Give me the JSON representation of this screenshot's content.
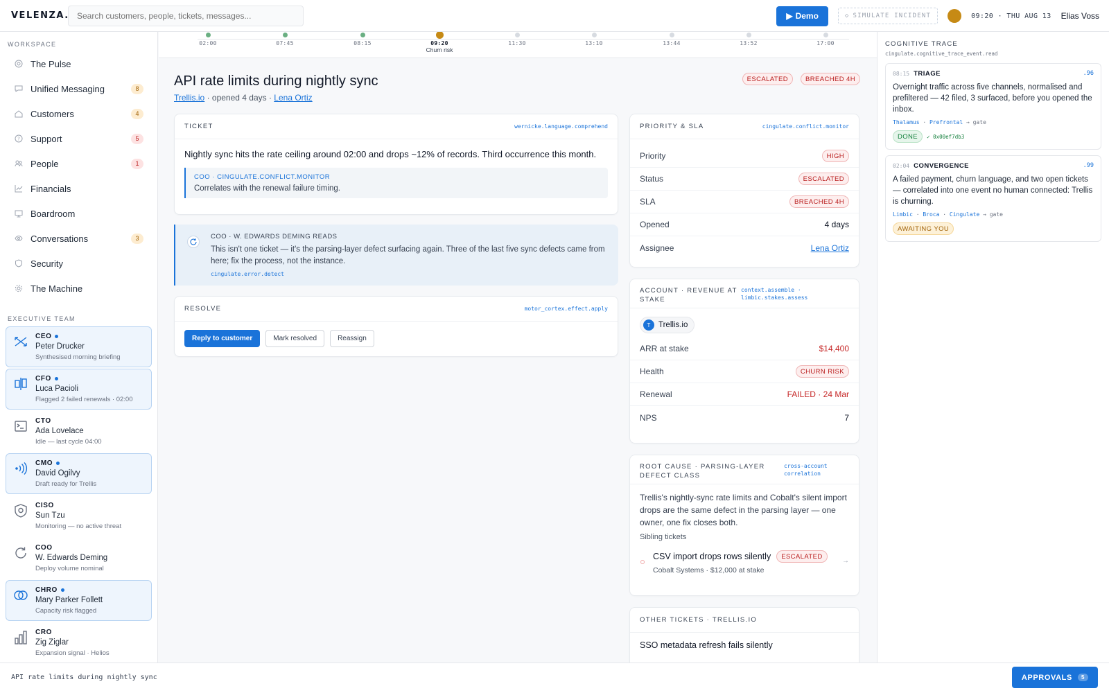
{
  "header": {
    "logo": "VELENZA.",
    "search_placeholder": "Search customers, people, tickets, messages...",
    "demo_label": "Demo",
    "simulate_label": "SIMULATE INCIDENT",
    "clock": "09:20 · THU AUG 13",
    "user": "Elias Voss"
  },
  "sidebar": {
    "workspace_label": "WORKSPACE",
    "items": [
      {
        "label": "The Pulse",
        "badge": "",
        "icon": "pulse-icon"
      },
      {
        "label": "Unified Messaging",
        "badge": "8",
        "icon": "message-icon"
      },
      {
        "label": "Customers",
        "badge": "4",
        "icon": "home-icon"
      },
      {
        "label": "Support",
        "badge": "5",
        "icon": "help-icon"
      },
      {
        "label": "People",
        "badge": "1",
        "icon": "people-icon"
      },
      {
        "label": "Financials",
        "badge": "",
        "icon": "chart-icon"
      },
      {
        "label": "Boardroom",
        "badge": "",
        "icon": "monitor-icon"
      },
      {
        "label": "Conversations",
        "badge": "3",
        "icon": "eye-icon"
      },
      {
        "label": "Security",
        "badge": "",
        "icon": "shield-icon"
      },
      {
        "label": "The Machine",
        "badge": "",
        "icon": "gear-icon"
      }
    ],
    "exec_label": "EXECUTIVE TEAM",
    "execs": [
      {
        "role": "CEO",
        "name": "Peter Drucker",
        "status": "Synthesised morning briefing",
        "active": true
      },
      {
        "role": "CFO",
        "name": "Luca Pacioli",
        "status": "Flagged 2 failed renewals · 02:00",
        "active": true
      },
      {
        "role": "CTO",
        "name": "Ada Lovelace",
        "status": "Idle — last cycle 04:00",
        "active": false
      },
      {
        "role": "CMO",
        "name": "David Ogilvy",
        "status": "Draft ready for Trellis",
        "active": true
      },
      {
        "role": "CISO",
        "name": "Sun Tzu",
        "status": "Monitoring — no active threat",
        "active": false
      },
      {
        "role": "COO",
        "name": "W. Edwards Deming",
        "status": "Deploy volume nominal",
        "active": false
      },
      {
        "role": "CHRO",
        "name": "Mary Parker Follett",
        "status": "Capacity risk flagged",
        "active": true
      },
      {
        "role": "CRO",
        "name": "Zig Ziglar",
        "status": "Expansion signal · Helios",
        "active": false
      }
    ]
  },
  "timeline": [
    {
      "time": "02:00",
      "state": "done",
      "label": ""
    },
    {
      "time": "07:45",
      "state": "done",
      "label": ""
    },
    {
      "time": "08:15",
      "state": "done",
      "label": ""
    },
    {
      "time": "09:20",
      "state": "now",
      "label": "Churn risk"
    },
    {
      "time": "11:30",
      "state": "future",
      "label": ""
    },
    {
      "time": "13:10",
      "state": "future",
      "label": ""
    },
    {
      "time": "13:44",
      "state": "future",
      "label": ""
    },
    {
      "time": "13:52",
      "state": "future",
      "label": ""
    },
    {
      "time": "17:00",
      "state": "future",
      "label": ""
    }
  ],
  "ticket_page": {
    "title": "API rate limits during nightly sync",
    "account": "Trellis.io",
    "opened": " · opened 4 days · ",
    "owner": "Lena Ortiz",
    "pill_escalated": "ESCALATED",
    "pill_breached": "BREACHED 4H"
  },
  "ticket_card": {
    "title": "TICKET",
    "tag": "wernicke.language.comprehend",
    "body": "Nightly sync hits the rate ceiling around 02:00 and drops ~12% of records. Third occurrence this month.",
    "quote_head": "COO · CINGULATE.CONFLICT.MONITOR",
    "quote_body": "Correlates with the renewal failure timing."
  },
  "deming": {
    "head": "COO · W. EDWARDS DEMING READS",
    "body": "This isn't one ticket — it's the parsing-layer defect surfacing again. Three of the last five sync defects came from here; fix the process, not the instance.",
    "tag": "cingulate.error.detect"
  },
  "resolve": {
    "title": "RESOLVE",
    "tag": "motor_cortex.effect.apply",
    "reply": "Reply to customer",
    "mark": "Mark resolved",
    "reassign": "Reassign"
  },
  "priority": {
    "title": "PRIORITY & SLA",
    "tag": "cingulate.conflict.monitor",
    "rows": [
      {
        "k": "Priority",
        "v": "HIGH"
      },
      {
        "k": "Status",
        "v": "ESCALATED"
      },
      {
        "k": "SLA",
        "v": "BREACHED 4H"
      },
      {
        "k": "Opened",
        "v": "4 days"
      },
      {
        "k": "Assignee",
        "v": "Lena Ortiz"
      }
    ]
  },
  "account": {
    "title_1": "ACCOUNT · REVENUE AT",
    "title_2": "STAKE",
    "tag_1": "context.assemble ·",
    "tag_2": "limbic.stakes.assess",
    "chip_letter": "T",
    "chip": "Trellis.io",
    "arr_k": "ARR at stake",
    "arr_v": "$14,400",
    "health_k": "Health",
    "health_v": "CHURN RISK",
    "renewal_k": "Renewal",
    "renewal_v": "FAILED · 24 Mar",
    "nps_k": "NPS",
    "nps_v": "7"
  },
  "root_cause": {
    "title_1": "ROOT CAUSE · PARSING-LAYER",
    "title_2": "DEFECT CLASS",
    "tag_1": "cross-account",
    "tag_2": "correlation",
    "body": "Trellis's nightly-sync rate limits and Cobalt's silent import drops are the same defect in the parsing layer — one owner, one fix closes both.",
    "sibling_label": "Sibling tickets",
    "sibling_title": "CSV import drops rows silently",
    "sibling_pill": "ESCALATED",
    "sibling_meta": "Cobalt Systems · $12,000 at stake"
  },
  "other": {
    "title": "OTHER TICKETS · TRELLIS.IO",
    "first": "SSO metadata refresh fails silently"
  },
  "trace": {
    "title": "COGNITIVE TRACE",
    "tag": "cingulate.cognitive_trace_event.read",
    "events": [
      {
        "time": "08:15",
        "kind": "TRIAGE",
        "score": ".96",
        "text": "Overnight traffic across five channels, normalised and prefiltered — 42 filed, 3 surfaced, before you opened the inbox.",
        "r1": "Thalamus",
        "r2": "Prefrontal",
        "gate": "→ gate",
        "status": "DONE",
        "hash": "✓ 0x00ef7db3"
      },
      {
        "time": "02:04",
        "kind": "CONVERGENCE",
        "score": ".99",
        "text": "A failed payment, churn language, and two open tickets — correlated into one event no human connected: Trellis is churning.",
        "r1": "Limbic",
        "r2": "Broca",
        "r3": "Cingulate",
        "gate": "→ gate",
        "status": "AWAITING YOU"
      }
    ]
  },
  "footer": {
    "context": "API rate limits during nightly sync",
    "approvals": "APPROVALS",
    "approvals_count": "5"
  },
  "colors": {
    "accent": "#1a73d9",
    "danger": "#c62828",
    "warning": "#a16207",
    "success": "#15803d",
    "now": "#c68a15"
  }
}
